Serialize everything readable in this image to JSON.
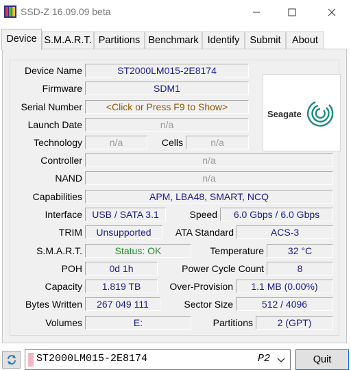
{
  "window": {
    "title": "SSD-Z 16.09.09 beta",
    "icon": "app-icon",
    "controls": [
      "minimize-icon",
      "maximize-icon",
      "close-icon"
    ]
  },
  "tabs": [
    {
      "label": "Device",
      "active": true
    },
    {
      "label": "S.M.A.R.T."
    },
    {
      "label": "Partitions"
    },
    {
      "label": "Benchmark"
    },
    {
      "label": "Identify"
    },
    {
      "label": "Submit"
    },
    {
      "label": "About"
    }
  ],
  "device": {
    "device_name": {
      "label": "Device Name",
      "value": "ST2000LM015-2E8174"
    },
    "firmware": {
      "label": "Firmware",
      "value": "SDM1"
    },
    "serial_number": {
      "label": "Serial Number",
      "value": "<Click or Press F9 to Show>"
    },
    "launch_date": {
      "label": "Launch Date",
      "value": "n/a"
    },
    "technology": {
      "label": "Technology",
      "value": "n/a"
    },
    "cells": {
      "label": "Cells",
      "value": "n/a"
    },
    "controller": {
      "label": "Controller",
      "value": "n/a"
    },
    "nand": {
      "label": "NAND",
      "value": "n/a"
    },
    "capabilities": {
      "label": "Capabilities",
      "value": "APM, LBA48, SMART, NCQ"
    },
    "interface": {
      "label": "Interface",
      "value": "USB / SATA 3.1"
    },
    "speed": {
      "label": "Speed",
      "value": "6.0 Gbps / 6.0 Gbps"
    },
    "trim": {
      "label": "TRIM",
      "value": "Unsupported"
    },
    "ata_standard": {
      "label": "ATA Standard",
      "value": "ACS-3"
    },
    "smart": {
      "label": "S.M.A.R.T.",
      "value": "Status: OK"
    },
    "temperature": {
      "label": "Temperature",
      "value": "32 °C"
    },
    "poh": {
      "label": "POH",
      "value": "0d 1h"
    },
    "power_cycle_count": {
      "label": "Power Cycle Count",
      "value": "8"
    },
    "capacity": {
      "label": "Capacity",
      "value": "1.819 TB"
    },
    "over_provision": {
      "label": "Over-Provision",
      "value": "1.1 MB (0.00%)"
    },
    "bytes_written": {
      "label": "Bytes Written",
      "value": "267 049 111"
    },
    "sector_size": {
      "label": "Sector Size",
      "value": "512 / 4096"
    },
    "volumes": {
      "label": "Volumes",
      "value": "E:"
    },
    "partitions": {
      "label": "Partitions",
      "value": "2 (GPT)"
    }
  },
  "logo": {
    "text": "Seagate"
  },
  "bottom": {
    "refresh_icon": "refresh-icon",
    "drive_select": {
      "value": "ST2000LM015-2E8174",
      "port": "P2"
    },
    "quit_label": "Quit"
  },
  "colors": {
    "value_blue": "#1a1a8c",
    "value_gray": "#9a9a9a",
    "value_brown": "#8a5a00",
    "value_green": "#1f8c2a",
    "drive_swatch": "#f4b4c2",
    "seagate_teal": "#1a8c80"
  }
}
